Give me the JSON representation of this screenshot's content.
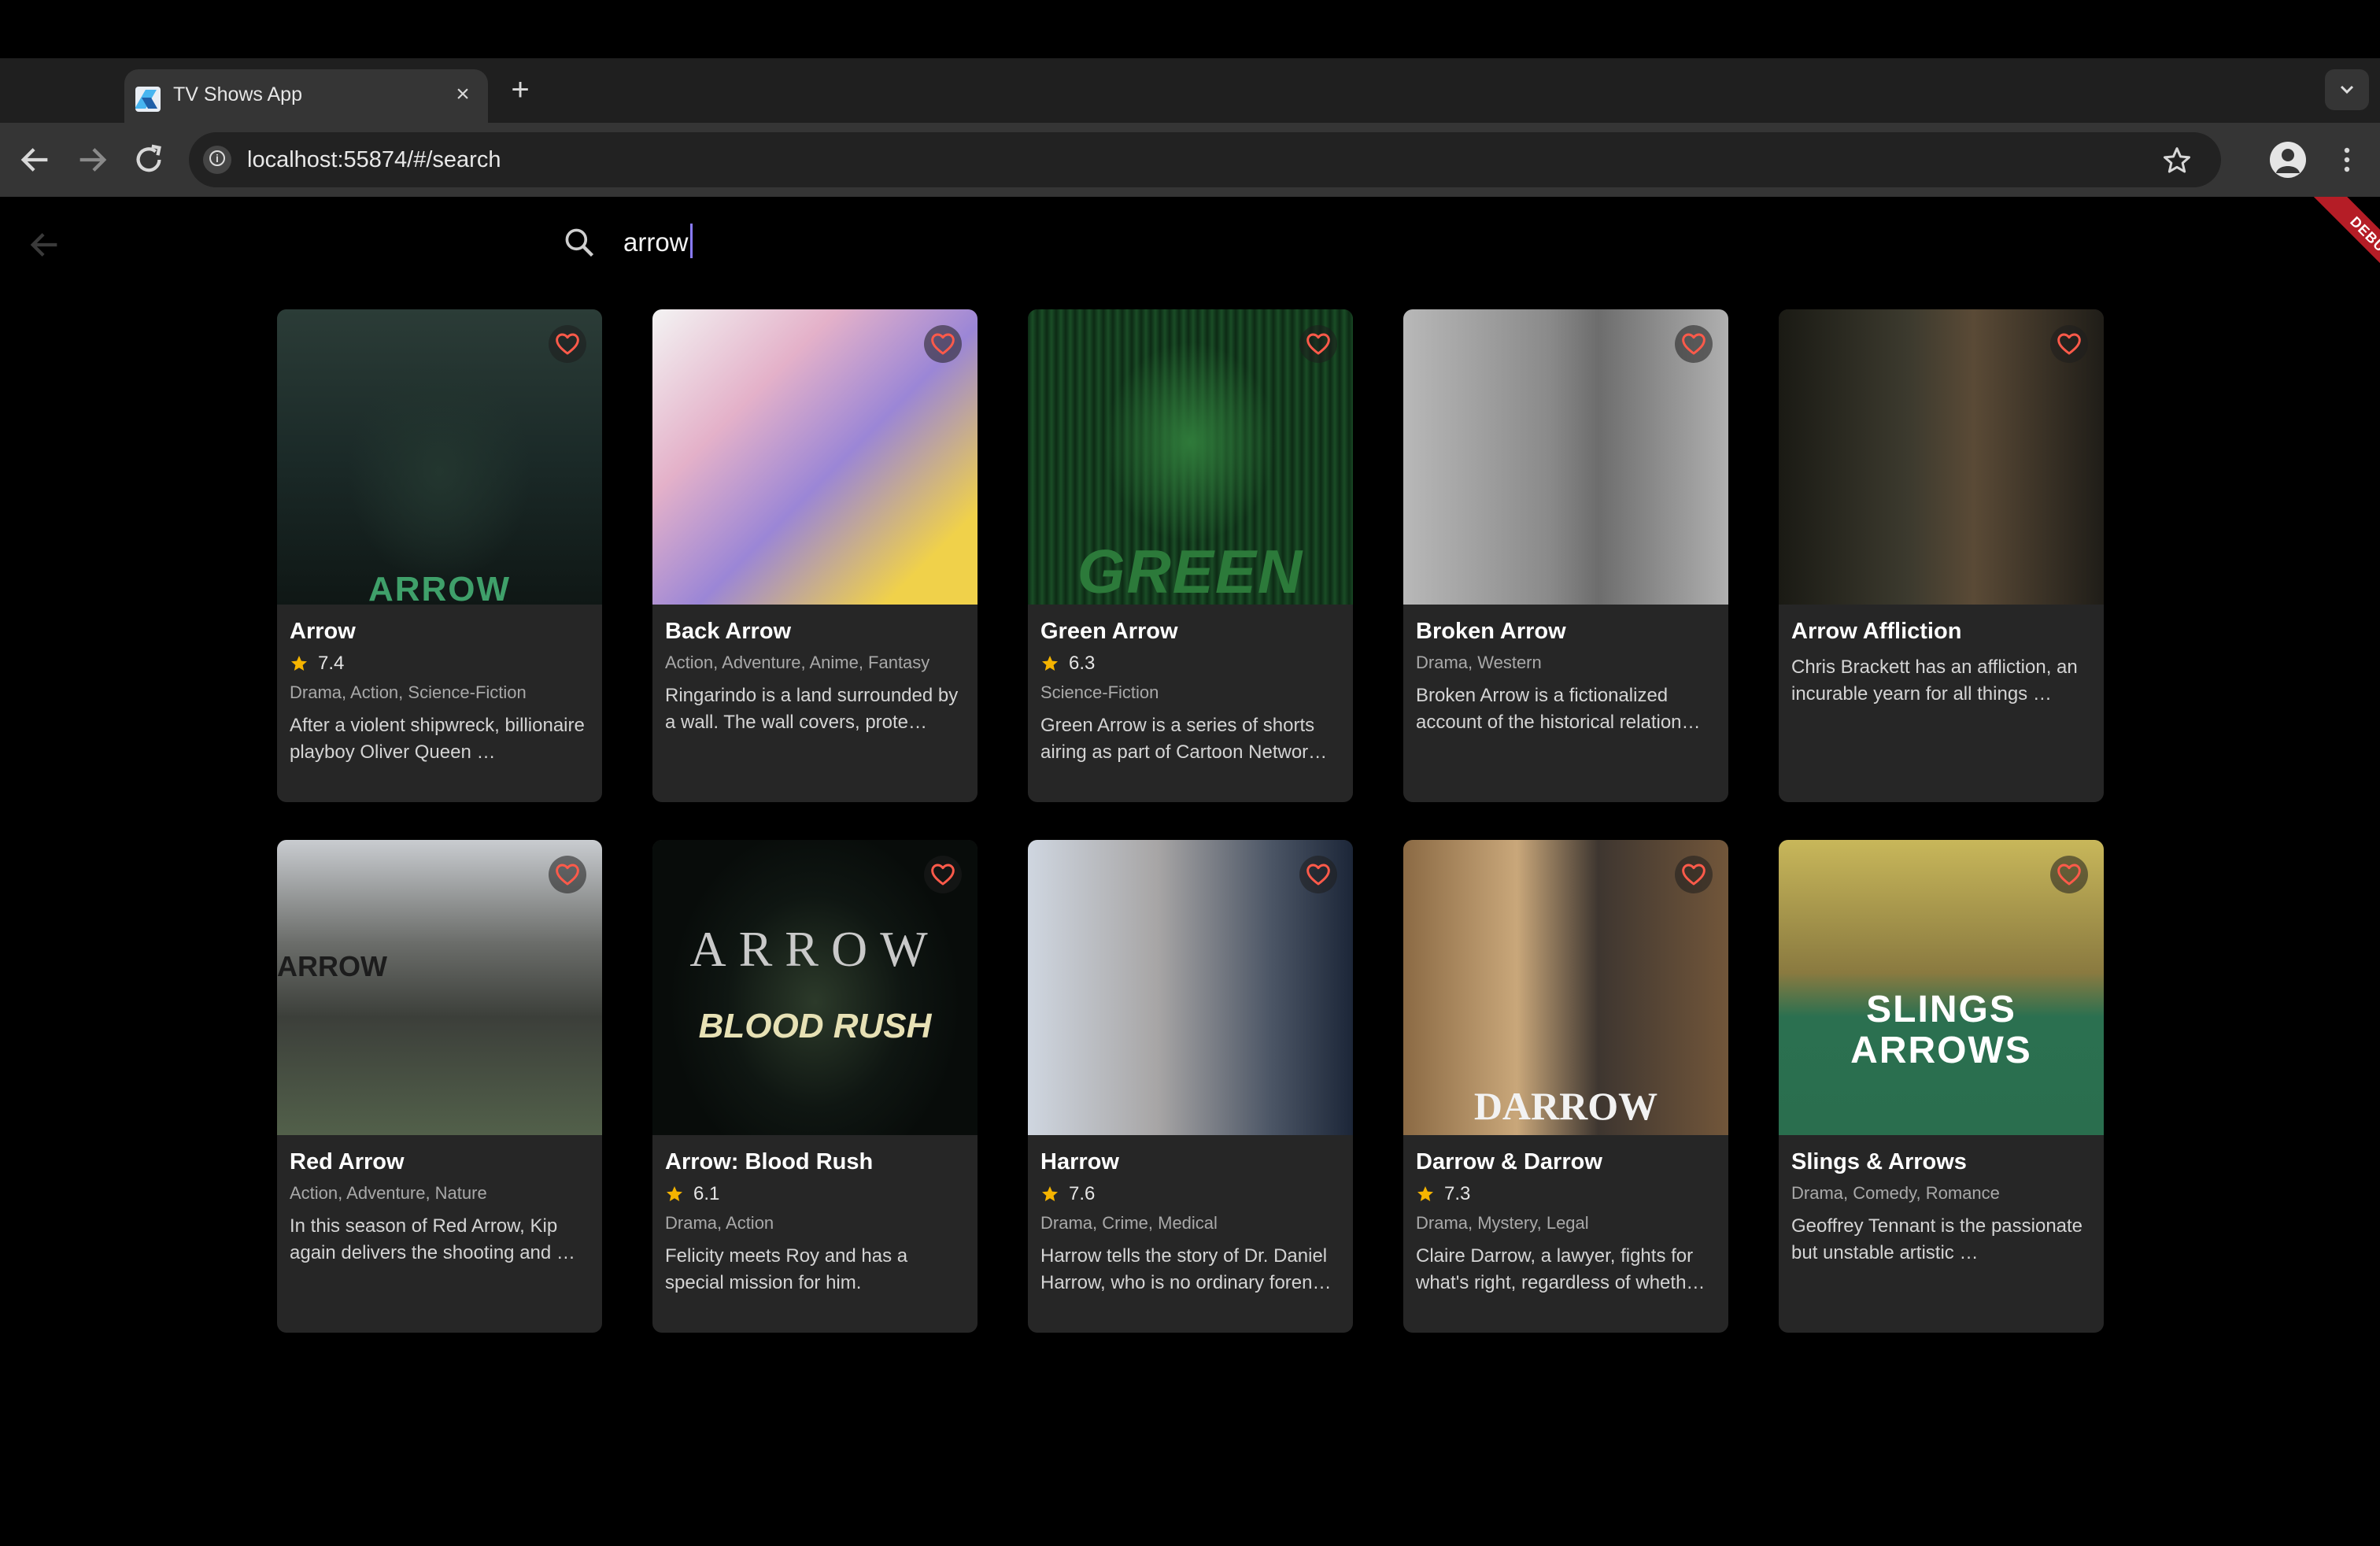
{
  "browser": {
    "tab_title": "TV Shows App",
    "url": "localhost:55874/#/search"
  },
  "app": {
    "search_query": "arrow",
    "debug_banner": "DEBUG"
  },
  "shows": [
    {
      "title": "Arrow",
      "rating": "7.4",
      "genres": "Drama, Action, Science-Fiction",
      "description": "After a violent shipwreck, billionaire playboy Oliver Queen …",
      "poster_caption": "ARROW"
    },
    {
      "title": "Back Arrow",
      "rating": null,
      "genres": "Action, Adventure, Anime, Fantasy",
      "description": "Ringarindo is a land surrounded by a wall. The wall covers, prote…",
      "poster_caption": ""
    },
    {
      "title": "Green Arrow",
      "rating": "6.3",
      "genres": "Science-Fiction",
      "description": "Green Arrow is a series of shorts airing as part of Cartoon Networ…",
      "poster_caption": "GREEN"
    },
    {
      "title": "Broken Arrow",
      "rating": null,
      "genres": "Drama, Western",
      "description": "Broken Arrow is a fictionalized account of the historical relation…",
      "poster_caption": ""
    },
    {
      "title": "Arrow Affliction",
      "rating": null,
      "genres": "",
      "description": "Chris Brackett has an affliction, an incurable yearn for all things …",
      "poster_caption": ""
    },
    {
      "title": "Red Arrow",
      "rating": null,
      "genres": "Action, Adventure, Nature",
      "description": "In this season of Red Arrow, Kip again delivers the shooting and …",
      "poster_caption": "ARROW"
    },
    {
      "title": "Arrow: Blood Rush",
      "rating": "6.1",
      "genres": "Drama, Action",
      "description": "Felicity meets Roy and has a special mission for him.",
      "poster_caption": "ARROW",
      "poster_caption2": "BLOOD RUSH"
    },
    {
      "title": "Harrow",
      "rating": "7.6",
      "genres": "Drama, Crime, Medical",
      "description": "Harrow tells the story of Dr. Daniel Harrow, who is no ordinary foren…",
      "poster_caption": ""
    },
    {
      "title": "Darrow & Darrow",
      "rating": "7.3",
      "genres": "Drama, Mystery, Legal",
      "description": "Claire Darrow, a lawyer, fights for what's right, regardless of wheth…",
      "poster_caption": "DARROW"
    },
    {
      "title": "Slings & Arrows",
      "rating": null,
      "genres": "Drama, Comedy, Romance",
      "description": "Geoffrey Tennant is the passionate but unstable artistic …",
      "poster_caption": "SLINGS",
      "poster_caption2": "ARROWS"
    }
  ],
  "colors": {
    "favorite_icon": "#ff5a4a",
    "star": "#f5b400",
    "card_bg": "#262626",
    "accent_caret": "#8a7bff"
  }
}
